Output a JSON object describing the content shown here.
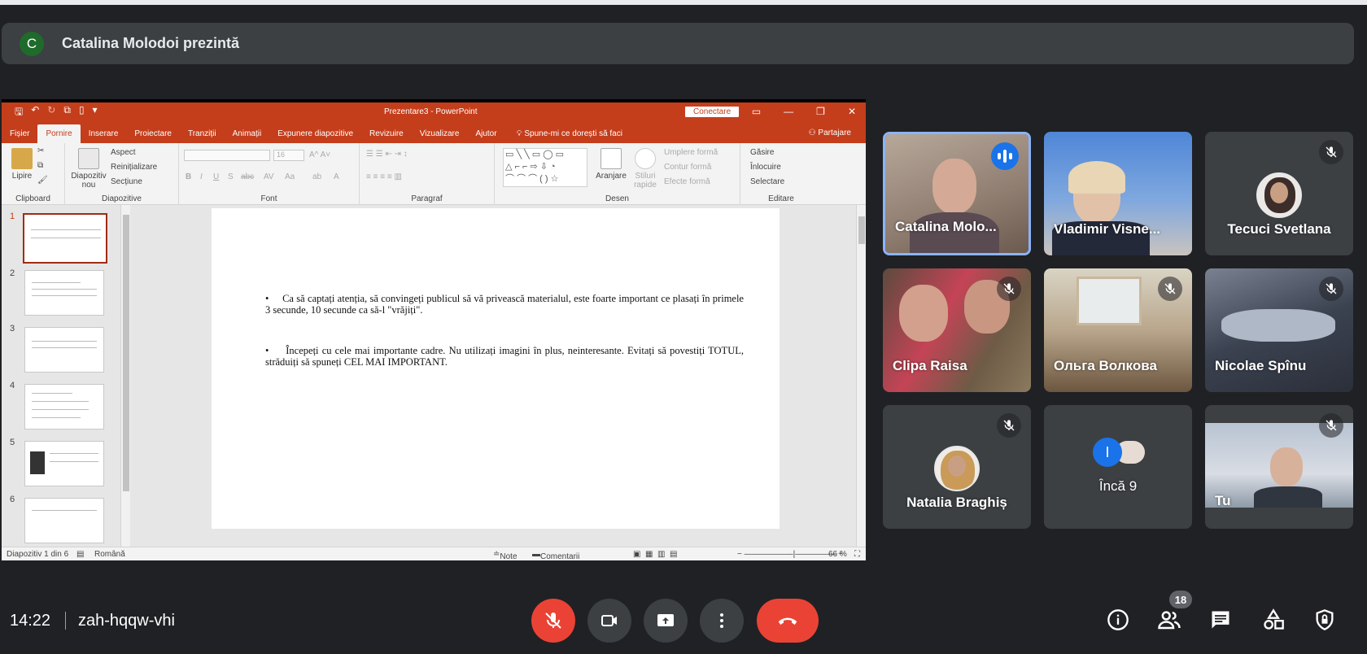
{
  "presenter_banner": {
    "avatar_letter": "C",
    "text": "Catalina Molodoi prezintă"
  },
  "powerpoint": {
    "window_title": "Prezentare3 - PowerPoint",
    "connect_label": "Conectare",
    "tabs": [
      "Fișier",
      "Pornire",
      "Inserare",
      "Proiectare",
      "Tranziții",
      "Animații",
      "Expunere diapozitive",
      "Revizuire",
      "Vizualizare",
      "Ajutor"
    ],
    "active_tab": "Pornire",
    "tell_me": "Spune-mi ce dorești să faci",
    "share_label": "Partajare",
    "ribbon": {
      "paste": "Lipire",
      "clipboard": "Clipboard",
      "new_slide_1": "Diapozitiv",
      "new_slide_2": "nou",
      "layout": "Aspect",
      "reset": "Reinițializare",
      "section": "Secțiune",
      "slides": "Diapozitive",
      "font": "Font",
      "font_size": "16",
      "paragraph": "Paragraf",
      "arrange": "Aranjare",
      "quick_styles_1": "Stiluri",
      "quick_styles_2": "rapide",
      "shape_fill": "Umplere formă",
      "shape_outline": "Contur formă",
      "shape_effects": "Efecte formă",
      "drawing": "Desen",
      "find": "Găsire",
      "replace": "Înlocuire",
      "select": "Selectare",
      "editing": "Editare"
    },
    "slide_numbers": [
      "1",
      "2",
      "3",
      "4",
      "5",
      "6"
    ],
    "slide_bullets": [
      "Ca să captați atenția, să convingeți publicul să vă privească materialul, este foarte important ce plasați în primele 3 secunde, 10 secunde ca să-l \"vrăjiți\".",
      "Începeți cu cele mai importante cadre. Nu utilizați imagini în plus, neinteresante. Evitați să povestiți TOTUL, străduiți să spuneți CEL MAI IMPORTANT."
    ],
    "status": {
      "slide_count": "Diapozitiv 1 din 6",
      "language": "Română",
      "notes": "Note",
      "comments": "Comentarii",
      "zoom": "66 %"
    }
  },
  "participants": [
    {
      "name": "Catalina Molo...",
      "state": "speaking"
    },
    {
      "name": "Vladimir Visne...",
      "state": "video"
    },
    {
      "name": "Tecuci Svetlana",
      "state": "muted"
    },
    {
      "name": "Clipa Raisa",
      "state": "muted"
    },
    {
      "name": "Ольга Волкова",
      "state": "muted"
    },
    {
      "name": "Nicolae Spînu",
      "state": "muted"
    },
    {
      "name": "Natalia Braghiș",
      "state": "muted"
    },
    {
      "name": "Încă 9",
      "avatar_letter": "I"
    },
    {
      "name": "Tu",
      "state": "muted"
    }
  ],
  "bottom_bar": {
    "time": "14:22",
    "meeting_code": "zah-hqqw-vhi",
    "people_count": "18"
  },
  "colors": {
    "background": "#202124",
    "tile": "#3c4043",
    "end_call": "#ea4335",
    "speaking_blue": "#1a73e8",
    "ppt_accent": "#c43e1c"
  }
}
